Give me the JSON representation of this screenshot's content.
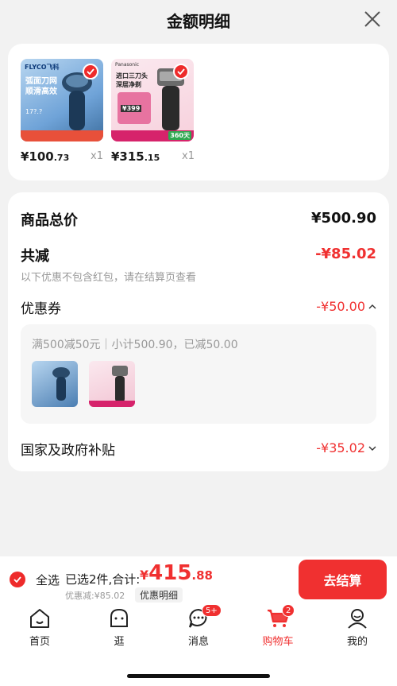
{
  "header": {
    "title": "金额明细"
  },
  "products": [
    {
      "price_main": "¥100",
      "price_dec": ".73",
      "qty": "x1",
      "brand": "FLYCO飞科",
      "headline": "弧面刀网",
      "headline2": "顺滑高效",
      "tag": "17?.?"
    },
    {
      "price_main": "¥315",
      "price_dec": ".15",
      "qty": "x1",
      "brand": "Panasonic",
      "headline": "进口三刀头",
      "headline2": "深层净剃",
      "tag": "¥399",
      "extra": "360天"
    }
  ],
  "summary": {
    "total_label": "商品总价",
    "total_value": "¥500.90",
    "reduce_label": "共减",
    "reduce_value": "-¥85.02",
    "reduce_note": "以下优惠不包含红包，请在结算页查看",
    "coupon_label": "优惠券",
    "coupon_value": "-¥50.00",
    "coupon_desc": "满500减50元｜小计500.90，已减50.00",
    "subsidy_label": "国家及政府补贴",
    "subsidy_value": "-¥35.02"
  },
  "checkout_bar": {
    "select_all": "全选",
    "selected_text": "已选2件,合计:",
    "total_symbol": "¥",
    "total_int": "415",
    "total_dec": ".88",
    "discount_text": "优惠减:¥85.02",
    "detail_link": "优惠明细",
    "checkout_button": "去结算"
  },
  "tabs": [
    {
      "label": "首页",
      "icon": "home-icon"
    },
    {
      "label": "逛",
      "icon": "discover-icon"
    },
    {
      "label": "消息",
      "icon": "message-icon",
      "badge": "5+"
    },
    {
      "label": "购物车",
      "icon": "cart-icon",
      "badge": "2",
      "active": true
    },
    {
      "label": "我的",
      "icon": "profile-icon"
    }
  ],
  "colors": {
    "accent": "#f03030",
    "text": "#111111",
    "muted": "#999999"
  }
}
